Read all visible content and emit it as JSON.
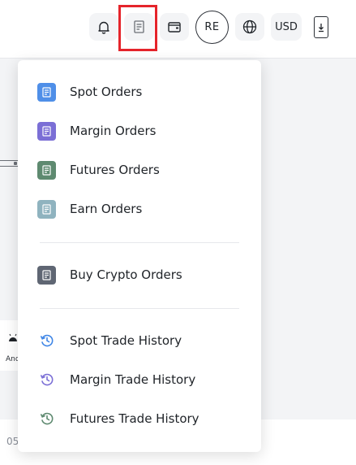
{
  "header": {
    "avatar_initials": "RE",
    "currency_label": "USD",
    "icons": {
      "notifications": "bell-icon",
      "orders": "document-icon",
      "wallet": "wallet-icon",
      "language": "globe-icon",
      "download": "download-icon"
    },
    "highlight_color": "#e5242b"
  },
  "orders_menu": {
    "order_items": [
      {
        "label": "Spot Orders",
        "icon": "document-icon",
        "color": "#4f8fe8"
      },
      {
        "label": "Margin Orders",
        "icon": "document-icon",
        "color": "#7b6fd6"
      },
      {
        "label": "Futures Orders",
        "icon": "document-icon",
        "color": "#5e8a70"
      },
      {
        "label": "Earn Orders",
        "icon": "document-icon",
        "color": "#8fb3bf"
      }
    ],
    "crypto_item": {
      "label": "Buy Crypto Orders",
      "icon": "document-icon",
      "color": "#5f6673"
    },
    "history_items": [
      {
        "label": "Spot Trade History",
        "icon": "clock-history-icon",
        "color": "#3f86e6"
      },
      {
        "label": "Margin Trade History",
        "icon": "clock-history-icon",
        "color": "#7b6fd6"
      },
      {
        "label": "Futures Trade History",
        "icon": "clock-history-icon",
        "color": "#5e8a70"
      }
    ]
  },
  "background": {
    "android_label": "And",
    "date_fragment": "05"
  }
}
